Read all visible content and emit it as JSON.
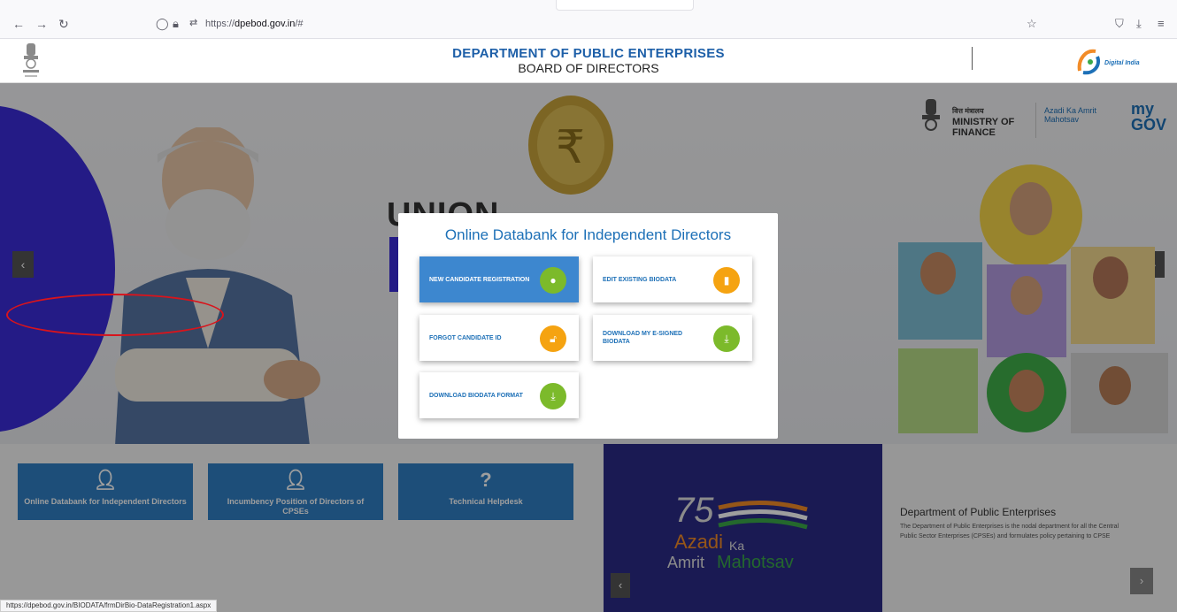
{
  "browser": {
    "url_prefix": "https://",
    "url_host": "dpebod.gov.in",
    "url_suffix": "/#",
    "status_url": "https://dpebod.gov.in/BIODATA/frmDirBio-DataRegistration1.aspx"
  },
  "header": {
    "title": "DEPARTMENT OF PUBLIC ENTERPRISES",
    "subtitle": "BOARD OF DIRECTORS",
    "digital_india": "Digital India"
  },
  "hero": {
    "union_text": "UNION",
    "ministry_lines": [
      "वित्त मंत्रालय",
      "MINISTRY OF",
      "FINANCE"
    ],
    "azadi_small": "Azadi Ka Amrit Mahotsav",
    "mygov": "my GOV"
  },
  "features": [
    {
      "icon": "user-icon",
      "label": "Online Databank for Independent Directors"
    },
    {
      "icon": "user-icon",
      "label": "Incumbency Position of Directors of CPSEs"
    },
    {
      "icon": "question-icon",
      "label": "Technical Helpdesk"
    }
  ],
  "azadi": {
    "word1": "Azadi",
    "word2": "Ka",
    "word3": "Amrit",
    "word4": "Mahotsav"
  },
  "dpe": {
    "title": "Department of Public Enterprises",
    "text": "The Department of Public Enterprises is the nodal department for all the Central Public Sector Enterprises (CPSEs) and formulates policy pertaining to CPSE"
  },
  "modal": {
    "title": "Online Databank for Independent Directors",
    "options": [
      {
        "label": "NEW CANDIDATE REGISTRATION",
        "icon": "user-icon",
        "color": "#7cba2b"
      },
      {
        "label": "EDIT EXISTING BIODATA",
        "icon": "document-icon",
        "color": "#f5a311"
      },
      {
        "label": "FORGOT CANDIDATE ID",
        "icon": "unlock-icon",
        "color": "#f5a311"
      },
      {
        "label": "DOWNLOAD MY E-SIGNED BIODATA",
        "icon": "download-icon",
        "color": "#7cba2b"
      },
      {
        "label": "DOWNLOAD BIODATA FORMAT",
        "icon": "download-icon",
        "color": "#7cba2b"
      }
    ]
  },
  "colors": {
    "brand_blue": "#1d70b7",
    "highlight_red": "#d8141c",
    "accent_purple": "#3b2cd8"
  }
}
